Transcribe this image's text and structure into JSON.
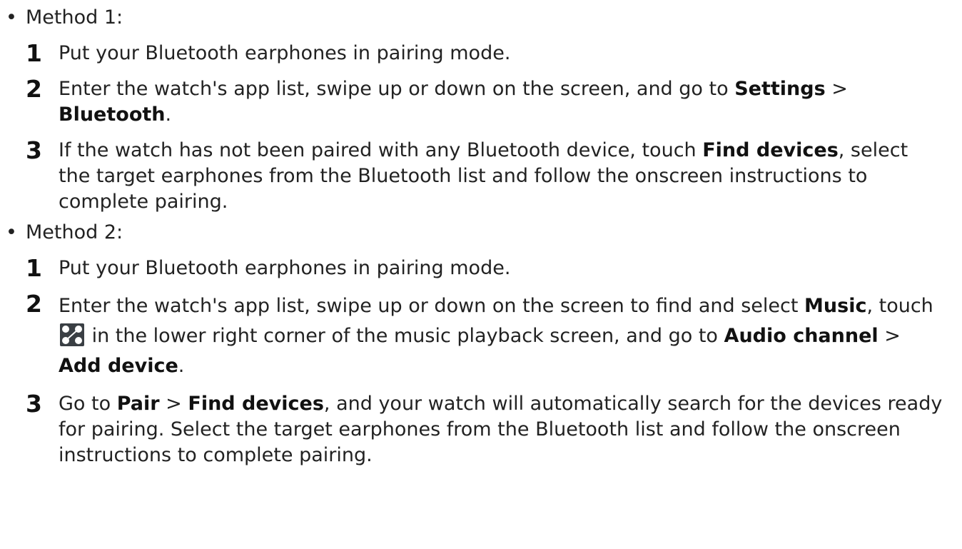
{
  "method1": {
    "bullet": "•",
    "title": "Method 1:",
    "steps": [
      {
        "num": "1",
        "text": "Put your Bluetooth earphones in pairing mode."
      },
      {
        "num": "2",
        "text_a": "Enter the watch's app list, swipe up or down on the screen, and go to ",
        "bold_a": "Settings",
        "text_b": " > ",
        "bold_b": "Bluetooth",
        "text_c": "."
      },
      {
        "num": "3",
        "text_a": "If the watch has not been paired with any Bluetooth device, touch ",
        "bold_a": "Find devices",
        "text_b": ", select the target earphones from the Bluetooth list and follow the onscreen instructions to complete pairing."
      }
    ]
  },
  "method2": {
    "bullet": "•",
    "title": "Method 2:",
    "steps": [
      {
        "num": "1",
        "text": "Put your Bluetooth earphones in pairing mode."
      },
      {
        "num": "2",
        "text_a": "Enter the watch's app list, swipe up or down on the screen to find and select ",
        "bold_a": "Music",
        "text_b": ", touch ",
        "icon": "audio-channel-icon",
        "text_c": " in the lower right corner of the music playback screen, and go to ",
        "bold_b": "Audio channel",
        "text_d": " > ",
        "bold_c": "Add device",
        "text_e": "."
      },
      {
        "num": "3",
        "text_a": "Go to ",
        "bold_a": "Pair",
        "text_b": " > ",
        "bold_b": "Find devices",
        "text_c": ", and your watch will automatically search for the devices ready for pairing. Select the target earphones from the Bluetooth list and follow the onscreen instructions to complete pairing."
      }
    ]
  }
}
